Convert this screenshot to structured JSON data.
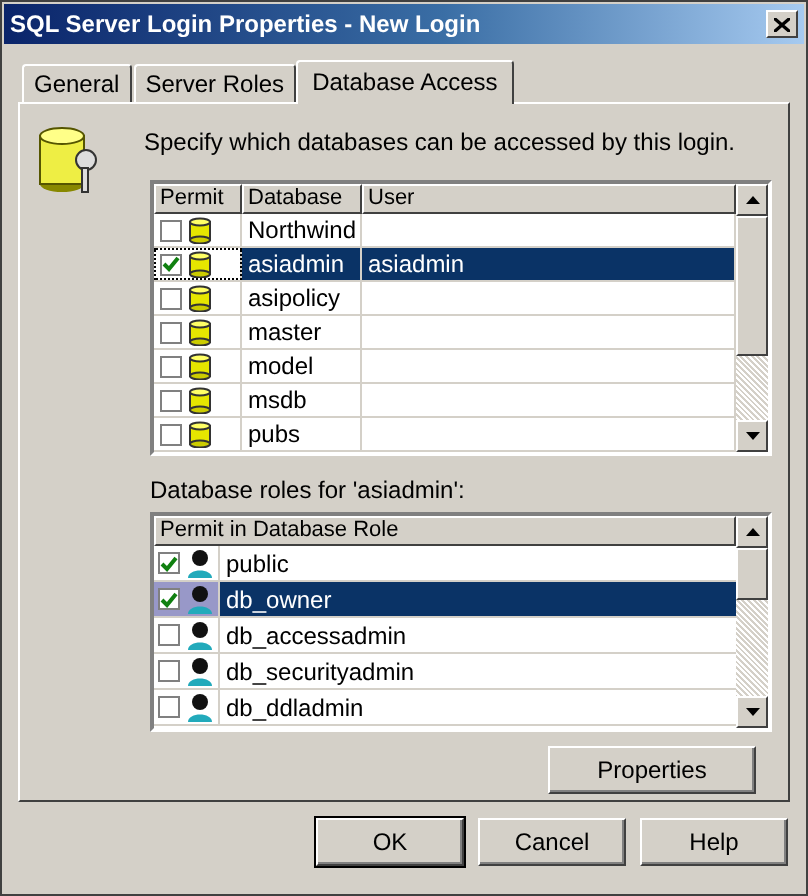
{
  "window": {
    "title": "SQL Server Login Properties - New Login"
  },
  "tabs": [
    {
      "label": "General",
      "selected": false
    },
    {
      "label": "Server Roles",
      "selected": false
    },
    {
      "label": "Database Access",
      "selected": true
    }
  ],
  "instruction": "Specify which databases can be accessed by this login.",
  "databases": {
    "columns": [
      "Permit",
      "Database",
      "User"
    ],
    "rows": [
      {
        "checked": false,
        "database": "Northwind",
        "user": "",
        "selected": false
      },
      {
        "checked": true,
        "database": "asiadmin",
        "user": "asiadmin",
        "selected": true
      },
      {
        "checked": false,
        "database": "asipolicy",
        "user": "",
        "selected": false
      },
      {
        "checked": false,
        "database": "master",
        "user": "",
        "selected": false
      },
      {
        "checked": false,
        "database": "model",
        "user": "",
        "selected": false
      },
      {
        "checked": false,
        "database": "msdb",
        "user": "",
        "selected": false
      },
      {
        "checked": false,
        "database": "pubs",
        "user": "",
        "selected": false
      }
    ]
  },
  "roles_label": "Database roles for 'asiadmin':",
  "roles": {
    "column": "Permit in Database Role",
    "rows": [
      {
        "checked": true,
        "name": "public",
        "selected": false
      },
      {
        "checked": true,
        "name": "db_owner",
        "selected": true
      },
      {
        "checked": false,
        "name": "db_accessadmin",
        "selected": false
      },
      {
        "checked": false,
        "name": "db_securityadmin",
        "selected": false
      },
      {
        "checked": false,
        "name": "db_ddladmin",
        "selected": false
      }
    ]
  },
  "properties_button": "Properties",
  "buttons": [
    "OK",
    "Cancel",
    "Help"
  ]
}
